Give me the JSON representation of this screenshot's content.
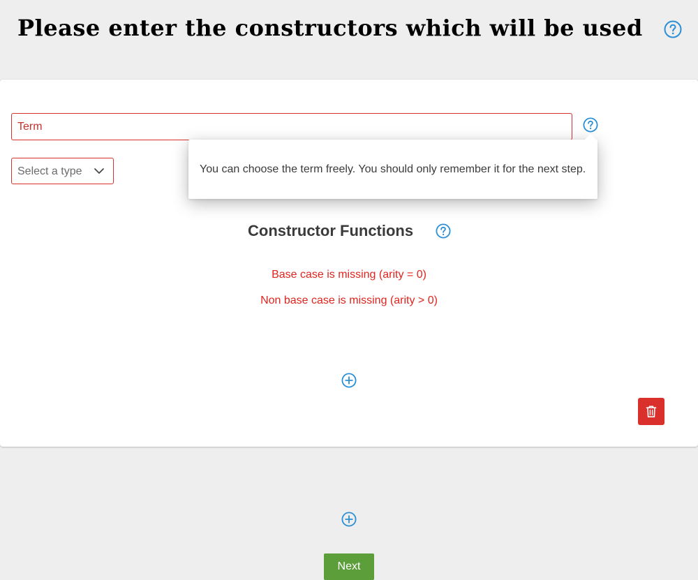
{
  "page": {
    "title": "Please enter the constructors which will be used"
  },
  "term": {
    "placeholder": "Term",
    "value": ""
  },
  "type_select": {
    "selected": "Select a type"
  },
  "tooltip": {
    "text": "You can choose the term freely. You should only remember it for the next step."
  },
  "constructor_functions": {
    "title": "Constructor Functions",
    "errors": [
      "Base case is missing (arity = 0)",
      "Non base case is missing (arity > 0)"
    ]
  },
  "actions": {
    "next_label": "Next"
  },
  "icons": {
    "help": "question-circle-icon",
    "add": "plus-circle-icon",
    "delete": "trash-icon",
    "dropdown": "chevron-down-icon"
  },
  "colors": {
    "accent": "#2a8fd6",
    "error": "#e0241d",
    "danger": "#d9302c",
    "success": "#5c9e3a",
    "background": "#eeeeee"
  }
}
